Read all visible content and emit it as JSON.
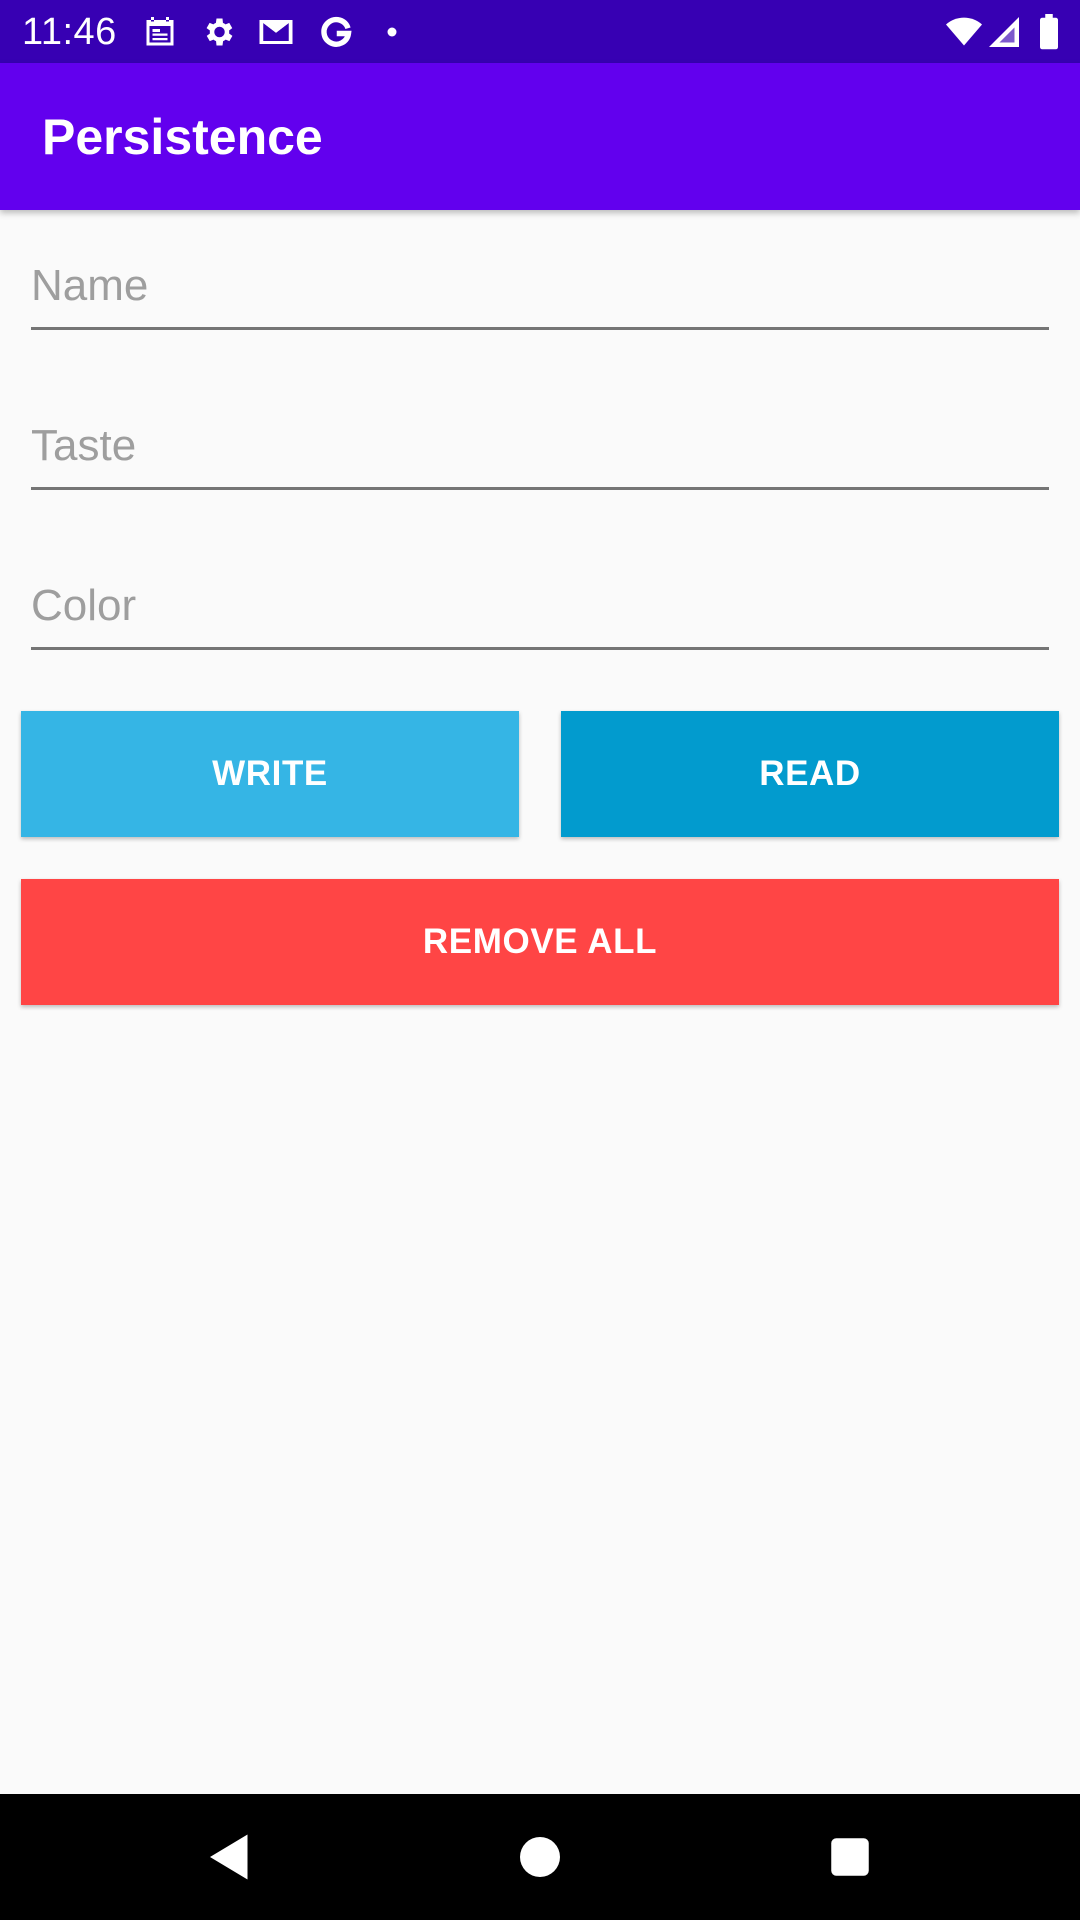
{
  "status_bar": {
    "time": "11:46",
    "left_icons": [
      "calendar-icon",
      "settings-gear-icon",
      "gmail-icon",
      "google-icon",
      "notification-dot-icon"
    ],
    "right_icons": [
      "wifi-icon",
      "cellular-signal-icon",
      "battery-icon"
    ],
    "background_color": "#3700B3"
  },
  "app_bar": {
    "title": "Persistence",
    "background_color": "#6200EE"
  },
  "form": {
    "name_placeholder": "Name",
    "name_value": "",
    "taste_placeholder": "Taste",
    "taste_value": "",
    "color_placeholder": "Color",
    "color_value": ""
  },
  "buttons": {
    "write_label": "WRITE",
    "write_color": "#35B5E5",
    "read_label": "READ",
    "read_color": "#029BCE",
    "remove_all_label": "REMOVE ALL",
    "remove_all_color": "#FF4545"
  },
  "nav_bar": {
    "icons": [
      "back-icon",
      "home-icon",
      "recents-icon"
    ]
  }
}
